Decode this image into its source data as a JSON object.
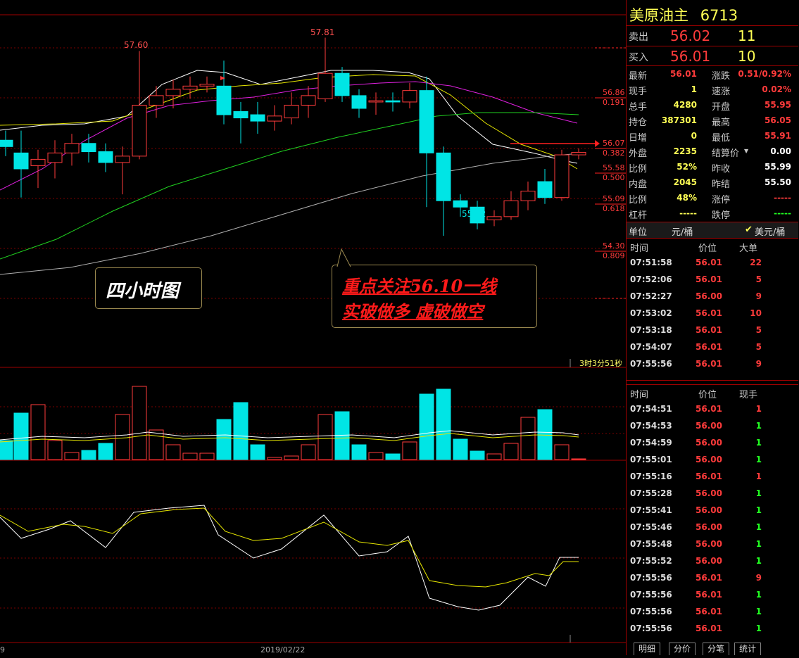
{
  "chart": {
    "price_labels": {
      "high1": "57.60",
      "high2": "57.81",
      "low": "55.02"
    },
    "fib_levels": [
      {
        "price": "56.86",
        "ratio": "0.191"
      },
      {
        "price": "56.07",
        "ratio": "0.382"
      },
      {
        "price": "55.58",
        "ratio": "0.500"
      },
      {
        "price": "55.09",
        "ratio": "0.618"
      },
      {
        "price": "54.30",
        "ratio": "0.809"
      }
    ],
    "label_period": "四小时图",
    "note_line1": "重点关注56.10一线",
    "note_line2": "实破做多 虚破做空",
    "countdown": "3时3分51秒",
    "date_label": "2019/02/22",
    "left_edge_tick": "9"
  },
  "quote": {
    "title": "美原油主",
    "code": "6713",
    "sell_label": "卖出",
    "sell_price": "56.02",
    "sell_qty": "11",
    "buy_label": "买入",
    "buy_price": "56.01",
    "buy_qty": "10",
    "stats": [
      {
        "l1": "最新",
        "v1": "56.01",
        "c1": "red",
        "l2": "涨跌",
        "v2": "0.51/0.92%",
        "c2": "red"
      },
      {
        "l1": "现手",
        "v1": "1",
        "c1": "yellow",
        "l2": "速涨",
        "v2": "0.02%",
        "c2": "red"
      },
      {
        "l1": "总手",
        "v1": "4280",
        "c1": "yellow",
        "l2": "开盘",
        "v2": "55.95",
        "c2": "red"
      },
      {
        "l1": "持仓",
        "v1": "387301",
        "c1": "yellow",
        "l2": "最高",
        "v2": "56.05",
        "c2": "red"
      },
      {
        "l1": "日增",
        "v1": "0",
        "c1": "yellow",
        "l2": "最低",
        "v2": "55.91",
        "c2": "red"
      },
      {
        "l1": "外盘",
        "v1": "2235",
        "c1": "yellow",
        "l2": "结算价",
        "v2": "0.00",
        "c2": "white"
      },
      {
        "l1": "比例",
        "v1": "52%",
        "c1": "yellow",
        "l2": "昨收",
        "v2": "55.99",
        "c2": "white"
      },
      {
        "l1": "内盘",
        "v1": "2045",
        "c1": "yellow",
        "l2": "昨结",
        "v2": "55.50",
        "c2": "white"
      },
      {
        "l1": "比例",
        "v1": "48%",
        "c1": "yellow",
        "l2": "涨停",
        "v2": "-----",
        "c2": "red"
      },
      {
        "l1": "杠杆",
        "v1": "-----",
        "c1": "yellow",
        "l2": "跌停",
        "v2": "-----",
        "c2": "green"
      }
    ],
    "unit_label": "单位",
    "unit_value": "元/桶",
    "unit_alt": "美元/桶"
  },
  "big_orders": {
    "headers": [
      "时间",
      "价位",
      "大单"
    ],
    "rows": [
      {
        "time": "07:51:58",
        "price": "56.01",
        "qty": "22",
        "c": "red"
      },
      {
        "time": "07:52:06",
        "price": "56.01",
        "qty": "5",
        "c": "red"
      },
      {
        "time": "07:52:27",
        "price": "56.00",
        "qty": "9",
        "c": "red"
      },
      {
        "time": "07:53:02",
        "price": "56.01",
        "qty": "10",
        "c": "red"
      },
      {
        "time": "07:53:18",
        "price": "56.01",
        "qty": "5",
        "c": "red"
      },
      {
        "time": "07:54:07",
        "price": "56.01",
        "qty": "5",
        "c": "red"
      },
      {
        "time": "07:55:56",
        "price": "56.01",
        "qty": "9",
        "c": "red"
      }
    ]
  },
  "ticks": {
    "headers": [
      "时间",
      "价位",
      "现手"
    ],
    "rows": [
      {
        "time": "07:54:51",
        "price": "56.01",
        "qty": "1",
        "c": "red"
      },
      {
        "time": "07:54:53",
        "price": "56.00",
        "qty": "1",
        "c": "green"
      },
      {
        "time": "07:54:59",
        "price": "56.00",
        "qty": "1",
        "c": "green"
      },
      {
        "time": "07:55:01",
        "price": "56.00",
        "qty": "1",
        "c": "green"
      },
      {
        "time": "07:55:16",
        "price": "56.01",
        "qty": "1",
        "c": "red"
      },
      {
        "time": "07:55:28",
        "price": "56.00",
        "qty": "1",
        "c": "green"
      },
      {
        "time": "07:55:41",
        "price": "56.00",
        "qty": "1",
        "c": "green"
      },
      {
        "time": "07:55:46",
        "price": "56.00",
        "qty": "1",
        "c": "green"
      },
      {
        "time": "07:55:48",
        "price": "56.00",
        "qty": "1",
        "c": "green"
      },
      {
        "time": "07:55:52",
        "price": "56.00",
        "qty": "1",
        "c": "green"
      },
      {
        "time": "07:55:56",
        "price": "56.01",
        "qty": "9",
        "c": "red"
      },
      {
        "time": "07:55:56",
        "price": "56.01",
        "qty": "1",
        "c": "green"
      },
      {
        "time": "07:55:56",
        "price": "56.01",
        "qty": "1",
        "c": "green"
      },
      {
        "time": "07:55:56",
        "price": "56.01",
        "qty": "1",
        "c": "green"
      }
    ]
  },
  "tabs": [
    "明细",
    "分价",
    "分笔",
    "统计"
  ],
  "colors": {
    "up": "#ff3b3b",
    "down": "#00e5e5",
    "grid": "#8b0000"
  }
}
